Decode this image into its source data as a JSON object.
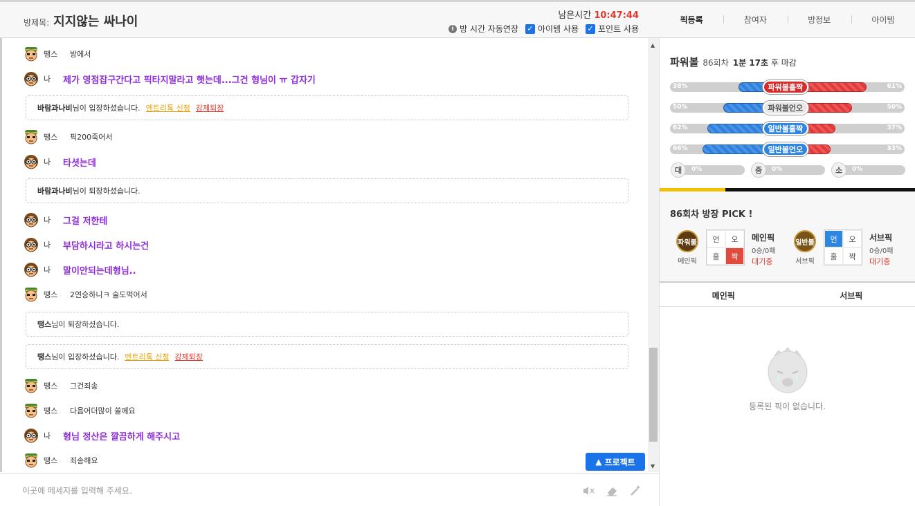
{
  "header": {
    "room_label": "방제목:",
    "room_title": "지지않는 싸나이",
    "timer_label": "남은시간",
    "timer_value": "10:47:44",
    "auto_extend": "방 시간 자동연장",
    "item_use": "아이템 사용",
    "point_use": "포인트 사용"
  },
  "tabs": [
    "픽등록",
    "참여자",
    "방정보",
    "아이템"
  ],
  "chat": {
    "messages": [
      {
        "type": "user",
        "avatar": "green",
        "nick": "땡스",
        "text": "방에서"
      },
      {
        "type": "me",
        "avatar": "glasses",
        "nick": "나",
        "text": "제가 영점잡구간다고 픽타지말라고 햇는데...그건 형님이 ㅠ 갑자기"
      },
      {
        "type": "notice",
        "who": "바람과나비",
        "text": "님이 입장하셨습니다.",
        "entry": "엔트리톡 신청",
        "kick": "강제퇴장"
      },
      {
        "type": "user",
        "avatar": "green",
        "nick": "땡스",
        "text": "픽200죽어서"
      },
      {
        "type": "me",
        "avatar": "glasses",
        "nick": "나",
        "text": "타셧는데"
      },
      {
        "type": "notice",
        "who": "바람과나비",
        "text": "님이 퇴장하셨습니다."
      },
      {
        "type": "me",
        "avatar": "glasses",
        "nick": "나",
        "text": "그걸 저한테"
      },
      {
        "type": "me",
        "avatar": "glasses",
        "nick": "나",
        "text": "부담하시라고 하시는건"
      },
      {
        "type": "me",
        "avatar": "glasses",
        "nick": "나",
        "text": "말이안되는데형님.."
      },
      {
        "type": "user",
        "avatar": "green",
        "nick": "땡스",
        "text": "2연승하니ㅋ 술도먹어서"
      },
      {
        "type": "notice",
        "who": "땡스",
        "text": "님이 퇴장하셨습니다."
      },
      {
        "type": "notice",
        "who": "땡스",
        "text": "님이 입장하셨습니다.",
        "entry": "엔트리톡 신청",
        "kick": "강제퇴장"
      },
      {
        "type": "user",
        "avatar": "green",
        "nick": "땡스",
        "text": "그건죄송"
      },
      {
        "type": "user",
        "avatar": "green",
        "nick": "땡스",
        "text": "다음어더많이 쏠께요"
      },
      {
        "type": "me",
        "avatar": "glasses",
        "nick": "나",
        "text": "형님 정산은 깔끔하게 해주시고"
      },
      {
        "type": "user",
        "avatar": "green",
        "nick": "땡스",
        "text": "죄송해요"
      }
    ]
  },
  "project_button": "프로젝트",
  "input": {
    "placeholder": "이곳에 메세지를 입력해 주세요."
  },
  "powerball": {
    "title": "파워볼",
    "round": "86회차",
    "deadline_time": "1분 17초",
    "deadline_suffix": "후 마감",
    "bars": [
      {
        "label": "파워볼홀짝",
        "left_pct": 38,
        "right_pct": 61,
        "left_text": "38%",
        "right_text": "61%",
        "badge": "red"
      },
      {
        "label": "파워볼언오",
        "left_pct": 50,
        "right_pct": 50,
        "left_text": "50%",
        "right_text": "50%",
        "badge": "gray"
      },
      {
        "label": "일반볼홀짝",
        "left_pct": 62,
        "right_pct": 37,
        "left_text": "62%",
        "right_text": "37%",
        "badge": "blue"
      },
      {
        "label": "일반볼언오",
        "left_pct": 66,
        "right_pct": 33,
        "left_text": "66%",
        "right_text": "33%",
        "badge": "blue"
      }
    ],
    "size_bars": [
      {
        "label": "대",
        "pct": "0%"
      },
      {
        "label": "중",
        "pct": "0%"
      },
      {
        "label": "소",
        "pct": "0%"
      }
    ]
  },
  "pick": {
    "title": "86회차 방장 PICK !",
    "main": {
      "ball": "파워볼",
      "ball_label": "메인픽",
      "cells": [
        "언",
        "오",
        "홀",
        "짝"
      ],
      "name": "메인픽",
      "record": "0승/0패",
      "status": "대기중"
    },
    "sub": {
      "ball": "일반볼",
      "ball_label": "서브픽",
      "cells": [
        "언",
        "오",
        "홀",
        "짝"
      ],
      "name": "서브픽",
      "record": "0승/0패",
      "status": "대기중"
    }
  },
  "subtabs": [
    "메인픽",
    "서브픽"
  ],
  "empty_text": "등록된 픽이 없습니다.",
  "colors": {
    "accent_blue": "#1a73e8",
    "me_text": "#8c2bd9",
    "timer": "#e03a2f",
    "entry": "#e8a100"
  }
}
